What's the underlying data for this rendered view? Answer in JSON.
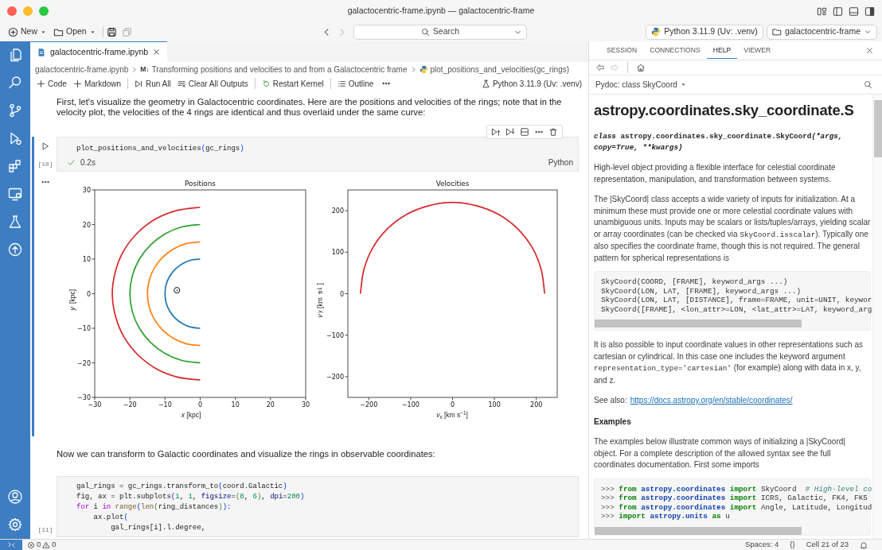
{
  "window": {
    "title": "galactocentric-frame.ipynb — galactocentric-frame"
  },
  "toolbar": {
    "new": "New",
    "open": "Open",
    "search": "Search",
    "interpreter": "Python 3.11.9 (Uv: .venv)",
    "folder": "galactocentric-frame"
  },
  "editor_tabs": [
    {
      "label": "galactocentric-frame.ipynb",
      "selected": true
    }
  ],
  "breadcrumb": [
    {
      "text": "galactocentric-frame.ipynb",
      "kind": "file"
    },
    {
      "text": "Transforming positions and velocities to and from a Galactocentric frame",
      "kind": "markdown",
      "badge": "M↓"
    },
    {
      "text": "plot_positions_and_velocities(gc_rings)",
      "kind": "python"
    }
  ],
  "notebook_toolbar": [
    {
      "label": "Code",
      "kind": "plus",
      "separator_before": false
    },
    {
      "label": "Markdown",
      "kind": "plus",
      "separator_before": false
    },
    {
      "label": "Run All",
      "kind": "run",
      "separator_before": true
    },
    {
      "label": "Clear All Outputs",
      "kind": "clear",
      "separator_before": false
    },
    {
      "label": "Restart Kernel",
      "kind": "restart",
      "separator_before": true
    },
    {
      "label": "Outline",
      "kind": "outline",
      "separator_before": true
    }
  ],
  "kernel": "Python 3.11.9 (Uv: .venv)",
  "cells": [
    {
      "kind": "markdown",
      "text": "First, let's visualize the geometry in Galactocentric coordinates. Here are the positions and velocities of the rings; note that in the velocity plot, the velocities of the 4 rings are identical and thus overlaid under the same curve:"
    },
    {
      "kind": "code",
      "selected": true,
      "execution_count": "[10]",
      "status": "0.2s",
      "language": "Python",
      "lines": [
        [
          {
            "text": "plot_positions_and_velocities",
            "kind": "plain"
          },
          {
            "text": "(",
            "kind": "paren"
          },
          {
            "text": "gc_rings",
            "kind": "plain"
          },
          {
            "text": ")",
            "kind": "paren"
          }
        ]
      ],
      "charts": [
        {
          "chart_data": {
            "type": "line",
            "title": "Positions",
            "xlabel": "*x* [kpc]",
            "ylabel": "*y* [kpc]",
            "xlim": [
              -30,
              30
            ],
            "ylim": [
              -30,
              30
            ],
            "xticks": [
              {
                "value": -30,
                "label": "−30"
              },
              {
                "value": -20,
                "label": "−20"
              },
              {
                "value": -10,
                "label": "−10"
              },
              0,
              10,
              20,
              30
            ],
            "yticks": [
              {
                "value": -30,
                "label": "−30"
              },
              {
                "value": -20,
                "label": "−20"
              },
              {
                "value": -10,
                "label": "−10"
              },
              0,
              10,
              20,
              30
            ],
            "series": [
              {
                "color": "#1f77b4",
                "x": [
                  0,
                  -2.6,
                  -5,
                  -7.1,
                  -8.7,
                  -9.7,
                  -10,
                  -9.7,
                  -8.7,
                  -7.1,
                  -5,
                  -2.6,
                  0
                ],
                "values": [
                  10,
                  9.7,
                  8.7,
                  7.1,
                  5,
                  2.6,
                  0,
                  -2.6,
                  -5,
                  -7.1,
                  -8.7,
                  -9.7,
                  -10
                ]
              },
              {
                "color": "#ff7f0e",
                "x": [
                  0,
                  -3.9,
                  -7.5,
                  -10.6,
                  -13,
                  -14.5,
                  -15,
                  -14.5,
                  -13,
                  -10.6,
                  -7.5,
                  -3.9,
                  0
                ],
                "values": [
                  15,
                  14.5,
                  13,
                  10.6,
                  7.5,
                  3.9,
                  0,
                  -3.9,
                  -7.5,
                  -10.6,
                  -13,
                  -14.5,
                  -15
                ]
              },
              {
                "color": "#2ca02c",
                "x": [
                  0,
                  -5.2,
                  -10,
                  -14.1,
                  -17.3,
                  -19.3,
                  -20,
                  -19.3,
                  -17.3,
                  -14.1,
                  -10,
                  -5.2,
                  0
                ],
                "values": [
                  20,
                  19.3,
                  17.3,
                  14.1,
                  10,
                  5.2,
                  0,
                  -5.2,
                  -10,
                  -14.1,
                  -17.3,
                  -19.3,
                  -20
                ]
              },
              {
                "color": "#d62728",
                "x": [
                  0,
                  -6.5,
                  -12.5,
                  -17.7,
                  -21.7,
                  -24.1,
                  -25,
                  -24.1,
                  -21.7,
                  -17.7,
                  -12.5,
                  -6.5,
                  0
                ],
                "values": [
                  25,
                  24.1,
                  21.7,
                  17.7,
                  12.5,
                  6.5,
                  0,
                  -6.5,
                  -12.5,
                  -17.7,
                  -21.7,
                  -24.1,
                  -25
                ]
              }
            ],
            "annotations": [
              "⊙"
            ]
          }
        },
        {
          "chart_data": {
            "type": "line",
            "title": "Velocities",
            "xlabel": "*v*$_{x}$ [km s$^{−1}$]",
            "ylabel": "*v*$_{y}$ [km s$^{−1}$]",
            "xlim": [
              -250,
              250
            ],
            "ylim": [
              -250,
              250
            ],
            "xticks": [
              {
                "value": -200,
                "label": "−200"
              },
              {
                "value": -100,
                "label": "−100"
              },
              0,
              100,
              200
            ],
            "yticks": [
              {
                "value": -200,
                "label": "−200"
              },
              {
                "value": -100,
                "label": "−100"
              },
              0,
              100,
              200
            ],
            "series": [
              {
                "color": "#d62728",
                "x": [
                  -220,
                  -212,
                  -191,
                  -156,
                  -110,
                  -57,
                  0,
                  57,
                  110,
                  156,
                  191,
                  212,
                  220
                ],
                "values": [
                  0,
                  57,
                  110,
                  156,
                  191,
                  212,
                  220,
                  212,
                  191,
                  156,
                  110,
                  57,
                  0
                ]
              }
            ]
          }
        }
      ]
    },
    {
      "kind": "markdown",
      "text": "Now we can transform to Galactic coordinates and visualize the rings in observable coordinates:"
    },
    {
      "kind": "code",
      "selected": false,
      "execution_count": "[11]",
      "lines": [
        [
          {
            "text": "gal_rings = gc_rings.transform_to",
            "kind": "plain"
          },
          {
            "text": "(",
            "kind": "paren"
          },
          {
            "text": "coord.Galactic",
            "kind": "plain"
          },
          {
            "text": ")",
            "kind": "paren"
          }
        ],
        [
          {
            "text": "fig, ax = plt.subplots",
            "kind": "plain"
          },
          {
            "text": "(",
            "kind": "paren"
          },
          {
            "text": "1",
            "kind": "number"
          },
          {
            "text": ", ",
            "kind": "plain"
          },
          {
            "text": "1",
            "kind": "number"
          },
          {
            "text": ", ",
            "kind": "plain"
          },
          {
            "text": "figsize",
            "kind": "param"
          },
          {
            "text": "=",
            "kind": "plain"
          },
          {
            "text": "(",
            "kind": "paren2"
          },
          {
            "text": "8",
            "kind": "number"
          },
          {
            "text": ", ",
            "kind": "plain"
          },
          {
            "text": "6",
            "kind": "number"
          },
          {
            "text": ")",
            "kind": "paren2"
          },
          {
            "text": ", ",
            "kind": "plain"
          },
          {
            "text": "dpi",
            "kind": "param"
          },
          {
            "text": "=",
            "kind": "plain"
          },
          {
            "text": "200",
            "kind": "number"
          },
          {
            "text": ")",
            "kind": "paren"
          }
        ],
        [
          {
            "text": "for",
            "kind": "keyword"
          },
          {
            "text": " i ",
            "kind": "plain"
          },
          {
            "text": "in ",
            "kind": "keyword"
          },
          {
            "text": "range",
            "kind": "builtin"
          },
          {
            "text": "(",
            "kind": "paren"
          },
          {
            "text": "len",
            "kind": "builtin"
          },
          {
            "text": "(",
            "kind": "paren2"
          },
          {
            "text": "ring_distances",
            "kind": "plain"
          },
          {
            "text": ")",
            "kind": "paren2"
          },
          {
            "text": ")",
            "kind": "paren"
          },
          {
            "text": ":",
            "kind": "plain"
          }
        ],
        [
          {
            "text": "    ax.plot",
            "kind": "plain"
          },
          {
            "text": "(",
            "kind": "paren"
          }
        ],
        [
          {
            "text": "        gal_rings[i].l.degree,",
            "kind": "plain"
          }
        ]
      ]
    }
  ],
  "panel": {
    "tabs": [
      {
        "label": "SESSION",
        "selected": false
      },
      {
        "label": "CONNECTIONS",
        "selected": false
      },
      {
        "label": "HELP",
        "selected": true
      },
      {
        "label": "VIEWER",
        "selected": false
      }
    ],
    "topic": "Pydoc: class SkyCoord",
    "heading": "astropy.coordinates.sky_coordinate.S",
    "blocks": [
      {
        "kind": "signature",
        "parts": [
          {
            "text": "class",
            "kind": "italic"
          },
          {
            "text": " astropy.coordinates.sky_coordinate.SkyCoord",
            "kind": "plain"
          },
          {
            "text": "(*args, copy=True, **kwargs)",
            "kind": "italic"
          }
        ]
      },
      {
        "kind": "paragraph",
        "parts": [
          {
            "text": "High-level object providing a flexible interface for celestial coordinate representation, manipulation, and transformation between systems.",
            "kind": "plain"
          }
        ]
      },
      {
        "kind": "paragraph",
        "parts": [
          {
            "text": "The |SkyCoord| class accepts a wide variety of inputs for initialization. At a minimum these must provide one or more celestial coordinate values with unambiguous units. Inputs may be scalars or lists/tuples/arrays, yielding scalar or array coordinates (can be checked via ",
            "kind": "plain"
          },
          {
            "text": "SkyCoord.isscalar",
            "kind": "code"
          },
          {
            "text": "). Typically one also specifies the coordinate frame, though this is not required. The general pattern for spherical representations is",
            "kind": "plain"
          }
        ]
      },
      {
        "kind": "code",
        "lines": [
          [
            {
              "text": "SkyCoord(COORD, [FRAME], keyword_args ...)",
              "kind": "plain"
            }
          ],
          [
            {
              "text": "SkyCoord(LON, LAT, [FRAME], keyword_args ...)",
              "kind": "plain"
            }
          ],
          [
            {
              "text": "SkyCoord(LON, LAT, [DISTANCE], frame=FRAME, unit=UNIT, keywor",
              "kind": "plain"
            }
          ],
          [
            {
              "text": "SkyCoord([FRAME], <lon_attr>=LON, <lat_attr>=LAT, keyword_arg",
              "kind": "plain"
            }
          ]
        ]
      },
      {
        "kind": "paragraph",
        "parts": [
          {
            "text": "It is also possible to input coordinate values in other representations such as cartesian or cylindrical. In this case one includes the keyword argument ",
            "kind": "plain"
          },
          {
            "text": "representation_type='cartesian'",
            "kind": "code"
          },
          {
            "text": " (for example) along with data in x, y, and z.",
            "kind": "plain"
          }
        ]
      },
      {
        "kind": "see_also",
        "label": "See also:",
        "link": "https://docs.astropy.org/en/stable/coordinates/"
      },
      {
        "kind": "subheading",
        "text": "Examples"
      },
      {
        "kind": "paragraph",
        "parts": [
          {
            "text": "The examples below illustrate common ways of initializing a |SkyCoord| object. For a complete description of the allowed syntax see the full coordinates documentation. First some imports",
            "kind": "plain"
          }
        ]
      },
      {
        "kind": "code",
        "lines": [
          [
            {
              "text": ">>> ",
              "kind": "prompt"
            },
            {
              "text": "from ",
              "kind": "keyword"
            },
            {
              "text": "astropy.coordinates ",
              "kind": "module"
            },
            {
              "text": "import",
              "kind": "keyword"
            },
            {
              "text": " SkyCoord  ",
              "kind": "plain"
            },
            {
              "text": "# High-level co",
              "kind": "comment"
            }
          ],
          [
            {
              "text": ">>> ",
              "kind": "prompt"
            },
            {
              "text": "from ",
              "kind": "keyword"
            },
            {
              "text": "astropy.coordinates ",
              "kind": "module"
            },
            {
              "text": "import",
              "kind": "keyword"
            },
            {
              "text": " ICRS, Galactic, FK4, FK5",
              "kind": "plain"
            }
          ],
          [
            {
              "text": ">>> ",
              "kind": "prompt"
            },
            {
              "text": "from ",
              "kind": "keyword"
            },
            {
              "text": "astropy.coordinates ",
              "kind": "module"
            },
            {
              "text": "import",
              "kind": "keyword"
            },
            {
              "text": " Angle, Latitude, Longitud",
              "kind": "plain"
            }
          ],
          [
            {
              "text": ">>> ",
              "kind": "prompt"
            },
            {
              "text": "import ",
              "kind": "keyword"
            },
            {
              "text": "astropy.units ",
              "kind": "module"
            },
            {
              "text": "as",
              "kind": "keyword"
            },
            {
              "text": " u",
              "kind": "plain"
            }
          ]
        ]
      }
    ]
  },
  "status_bar": {
    "errors": "0",
    "warnings": "0",
    "spaces": "Spaces: 4",
    "braces": "{}",
    "cell": "Cell 21 of 23"
  }
}
